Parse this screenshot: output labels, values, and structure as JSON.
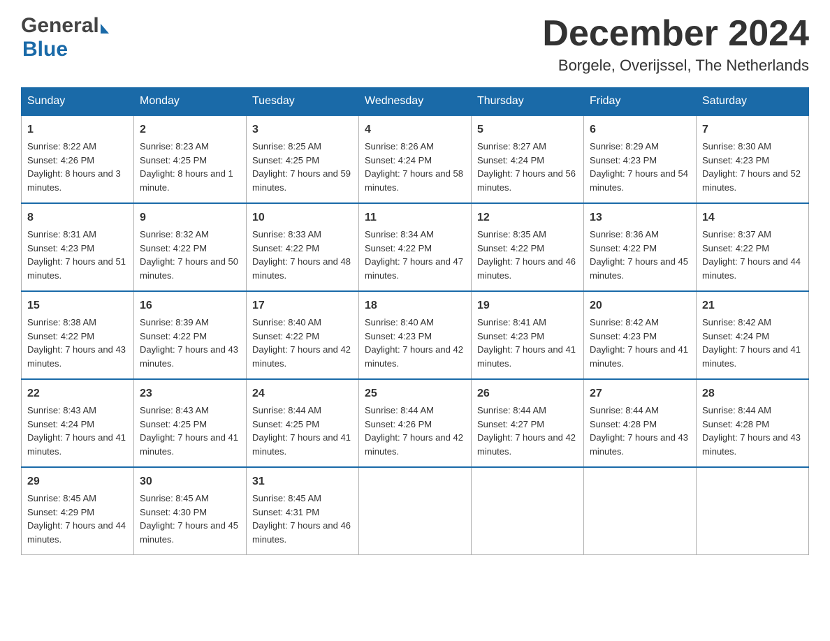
{
  "header": {
    "logo_general": "General",
    "logo_blue": "Blue",
    "month_title": "December 2024",
    "location": "Borgele, Overijssel, The Netherlands"
  },
  "days_of_week": [
    "Sunday",
    "Monday",
    "Tuesday",
    "Wednesday",
    "Thursday",
    "Friday",
    "Saturday"
  ],
  "weeks": [
    [
      {
        "day": "1",
        "sunrise": "Sunrise: 8:22 AM",
        "sunset": "Sunset: 4:26 PM",
        "daylight": "Daylight: 8 hours and 3 minutes."
      },
      {
        "day": "2",
        "sunrise": "Sunrise: 8:23 AM",
        "sunset": "Sunset: 4:25 PM",
        "daylight": "Daylight: 8 hours and 1 minute."
      },
      {
        "day": "3",
        "sunrise": "Sunrise: 8:25 AM",
        "sunset": "Sunset: 4:25 PM",
        "daylight": "Daylight: 7 hours and 59 minutes."
      },
      {
        "day": "4",
        "sunrise": "Sunrise: 8:26 AM",
        "sunset": "Sunset: 4:24 PM",
        "daylight": "Daylight: 7 hours and 58 minutes."
      },
      {
        "day": "5",
        "sunrise": "Sunrise: 8:27 AM",
        "sunset": "Sunset: 4:24 PM",
        "daylight": "Daylight: 7 hours and 56 minutes."
      },
      {
        "day": "6",
        "sunrise": "Sunrise: 8:29 AM",
        "sunset": "Sunset: 4:23 PM",
        "daylight": "Daylight: 7 hours and 54 minutes."
      },
      {
        "day": "7",
        "sunrise": "Sunrise: 8:30 AM",
        "sunset": "Sunset: 4:23 PM",
        "daylight": "Daylight: 7 hours and 52 minutes."
      }
    ],
    [
      {
        "day": "8",
        "sunrise": "Sunrise: 8:31 AM",
        "sunset": "Sunset: 4:23 PM",
        "daylight": "Daylight: 7 hours and 51 minutes."
      },
      {
        "day": "9",
        "sunrise": "Sunrise: 8:32 AM",
        "sunset": "Sunset: 4:22 PM",
        "daylight": "Daylight: 7 hours and 50 minutes."
      },
      {
        "day": "10",
        "sunrise": "Sunrise: 8:33 AM",
        "sunset": "Sunset: 4:22 PM",
        "daylight": "Daylight: 7 hours and 48 minutes."
      },
      {
        "day": "11",
        "sunrise": "Sunrise: 8:34 AM",
        "sunset": "Sunset: 4:22 PM",
        "daylight": "Daylight: 7 hours and 47 minutes."
      },
      {
        "day": "12",
        "sunrise": "Sunrise: 8:35 AM",
        "sunset": "Sunset: 4:22 PM",
        "daylight": "Daylight: 7 hours and 46 minutes."
      },
      {
        "day": "13",
        "sunrise": "Sunrise: 8:36 AM",
        "sunset": "Sunset: 4:22 PM",
        "daylight": "Daylight: 7 hours and 45 minutes."
      },
      {
        "day": "14",
        "sunrise": "Sunrise: 8:37 AM",
        "sunset": "Sunset: 4:22 PM",
        "daylight": "Daylight: 7 hours and 44 minutes."
      }
    ],
    [
      {
        "day": "15",
        "sunrise": "Sunrise: 8:38 AM",
        "sunset": "Sunset: 4:22 PM",
        "daylight": "Daylight: 7 hours and 43 minutes."
      },
      {
        "day": "16",
        "sunrise": "Sunrise: 8:39 AM",
        "sunset": "Sunset: 4:22 PM",
        "daylight": "Daylight: 7 hours and 43 minutes."
      },
      {
        "day": "17",
        "sunrise": "Sunrise: 8:40 AM",
        "sunset": "Sunset: 4:22 PM",
        "daylight": "Daylight: 7 hours and 42 minutes."
      },
      {
        "day": "18",
        "sunrise": "Sunrise: 8:40 AM",
        "sunset": "Sunset: 4:23 PM",
        "daylight": "Daylight: 7 hours and 42 minutes."
      },
      {
        "day": "19",
        "sunrise": "Sunrise: 8:41 AM",
        "sunset": "Sunset: 4:23 PM",
        "daylight": "Daylight: 7 hours and 41 minutes."
      },
      {
        "day": "20",
        "sunrise": "Sunrise: 8:42 AM",
        "sunset": "Sunset: 4:23 PM",
        "daylight": "Daylight: 7 hours and 41 minutes."
      },
      {
        "day": "21",
        "sunrise": "Sunrise: 8:42 AM",
        "sunset": "Sunset: 4:24 PM",
        "daylight": "Daylight: 7 hours and 41 minutes."
      }
    ],
    [
      {
        "day": "22",
        "sunrise": "Sunrise: 8:43 AM",
        "sunset": "Sunset: 4:24 PM",
        "daylight": "Daylight: 7 hours and 41 minutes."
      },
      {
        "day": "23",
        "sunrise": "Sunrise: 8:43 AM",
        "sunset": "Sunset: 4:25 PM",
        "daylight": "Daylight: 7 hours and 41 minutes."
      },
      {
        "day": "24",
        "sunrise": "Sunrise: 8:44 AM",
        "sunset": "Sunset: 4:25 PM",
        "daylight": "Daylight: 7 hours and 41 minutes."
      },
      {
        "day": "25",
        "sunrise": "Sunrise: 8:44 AM",
        "sunset": "Sunset: 4:26 PM",
        "daylight": "Daylight: 7 hours and 42 minutes."
      },
      {
        "day": "26",
        "sunrise": "Sunrise: 8:44 AM",
        "sunset": "Sunset: 4:27 PM",
        "daylight": "Daylight: 7 hours and 42 minutes."
      },
      {
        "day": "27",
        "sunrise": "Sunrise: 8:44 AM",
        "sunset": "Sunset: 4:28 PM",
        "daylight": "Daylight: 7 hours and 43 minutes."
      },
      {
        "day": "28",
        "sunrise": "Sunrise: 8:44 AM",
        "sunset": "Sunset: 4:28 PM",
        "daylight": "Daylight: 7 hours and 43 minutes."
      }
    ],
    [
      {
        "day": "29",
        "sunrise": "Sunrise: 8:45 AM",
        "sunset": "Sunset: 4:29 PM",
        "daylight": "Daylight: 7 hours and 44 minutes."
      },
      {
        "day": "30",
        "sunrise": "Sunrise: 8:45 AM",
        "sunset": "Sunset: 4:30 PM",
        "daylight": "Daylight: 7 hours and 45 minutes."
      },
      {
        "day": "31",
        "sunrise": "Sunrise: 8:45 AM",
        "sunset": "Sunset: 4:31 PM",
        "daylight": "Daylight: 7 hours and 46 minutes."
      },
      null,
      null,
      null,
      null
    ]
  ]
}
